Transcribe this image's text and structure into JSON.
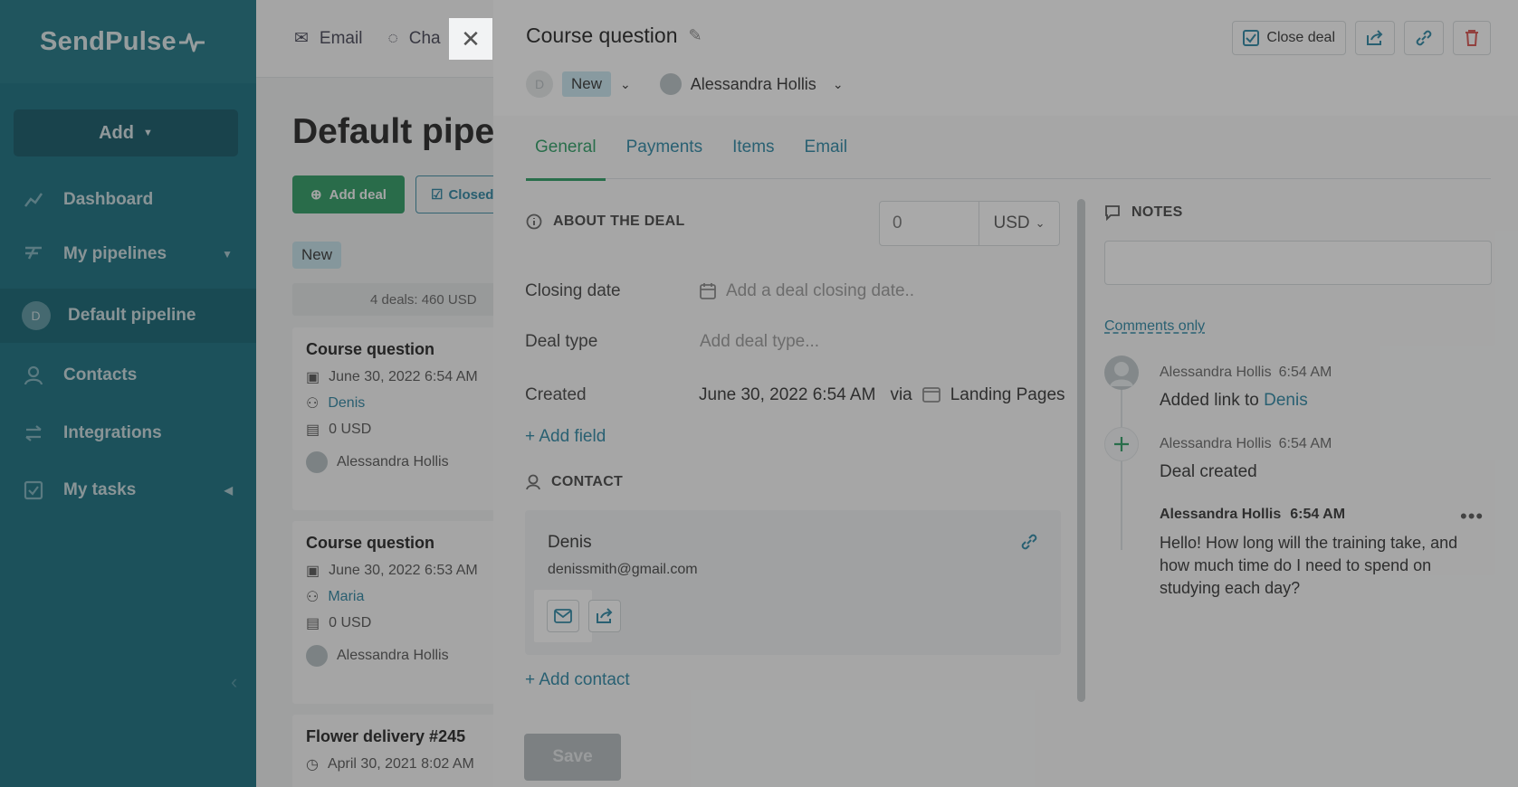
{
  "sidebar": {
    "logo": "SendPulse",
    "add_label": "Add",
    "items": [
      {
        "label": "Dashboard"
      },
      {
        "label": "My pipelines"
      },
      {
        "label": "Default pipeline",
        "avatar": "D"
      },
      {
        "label": "Contacts"
      },
      {
        "label": "Integrations"
      },
      {
        "label": "My tasks"
      }
    ]
  },
  "topnav": {
    "email": "Email",
    "chat": "Cha"
  },
  "main": {
    "title": "Default pipe",
    "add_deal": "Add deal",
    "closed": "Closed",
    "stage": "New",
    "stage_summary": "4 deals: 460 USD",
    "cards": [
      {
        "title": "Course question",
        "date": "June 30, 2022 6:54 AM",
        "contact": "Denis",
        "amount": "0 USD",
        "owner": "Alessandra Hollis"
      },
      {
        "title": "Course question",
        "date": "June 30, 2022 6:53 AM",
        "contact": "Maria",
        "amount": "0 USD",
        "owner": "Alessandra Hollis"
      },
      {
        "title": "Flower delivery #245",
        "date": "April 30, 2021 8:02 AM"
      }
    ]
  },
  "panel": {
    "title": "Course question",
    "close_deal": "Close deal",
    "avatar_letter": "D",
    "stage": "New",
    "owner": "Alessandra Hollis",
    "tabs": [
      "General",
      "Payments",
      "Items",
      "Email"
    ],
    "about_title": "ABOUT THE DEAL",
    "amount_value": "0",
    "currency": "USD",
    "fields": {
      "closing_date_label": "Closing date",
      "closing_date_placeholder": "Add a deal closing date..",
      "deal_type_label": "Deal type",
      "deal_type_placeholder": "Add deal type...",
      "created_label": "Created",
      "created_value": "June 30, 2022 6:54 AM",
      "via": "via",
      "source": "Landing Pages"
    },
    "add_field": "+ Add field",
    "contact_title": "CONTACT",
    "contact": {
      "name": "Denis",
      "email": "denissmith@gmail.com"
    },
    "add_contact": "+ Add contact",
    "save": "Save",
    "notes_title": "NOTES",
    "filter": "Comments only",
    "timeline": [
      {
        "author": "Alessandra Hollis",
        "time": "6:54 AM",
        "text_prefix": "Added link to ",
        "link": "Denis"
      },
      {
        "author": "Alessandra Hollis",
        "time": "6:54 AM",
        "text": "Deal created"
      }
    ],
    "comment": {
      "author": "Alessandra Hollis",
      "time": "6:54 AM",
      "text": "Hello! How long will the training take, and how much time do I need to spend on studying each day?"
    }
  },
  "colors": {
    "brand": "#136e80",
    "accent": "#2a9d63",
    "link": "#2a86a4"
  }
}
